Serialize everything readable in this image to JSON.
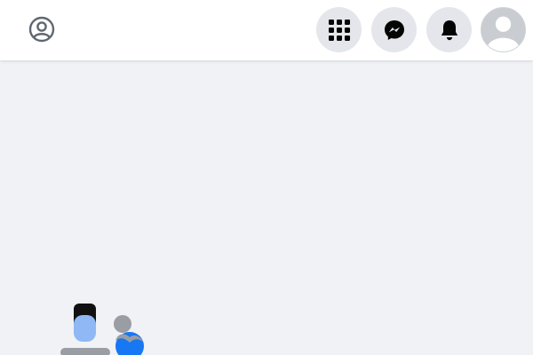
{
  "window": {
    "background": "#f0f2f5"
  },
  "header": {
    "left_icon": "profile-circle-icon",
    "buttons": [
      {
        "name": "menu",
        "icon": "grid-menu-icon"
      },
      {
        "name": "messenger",
        "icon": "messenger-icon"
      },
      {
        "name": "notifications",
        "icon": "bell-icon"
      },
      {
        "name": "account",
        "icon": "avatar-icon"
      }
    ],
    "button_background": "#e4e6eb"
  },
  "main": {
    "illustration": "people-illustration",
    "colors": {
      "person_dark": "#111111",
      "person_light_blue": "#8fb8f5",
      "person_gray": "#9a9da3",
      "accent_blue": "#1877f2"
    }
  }
}
